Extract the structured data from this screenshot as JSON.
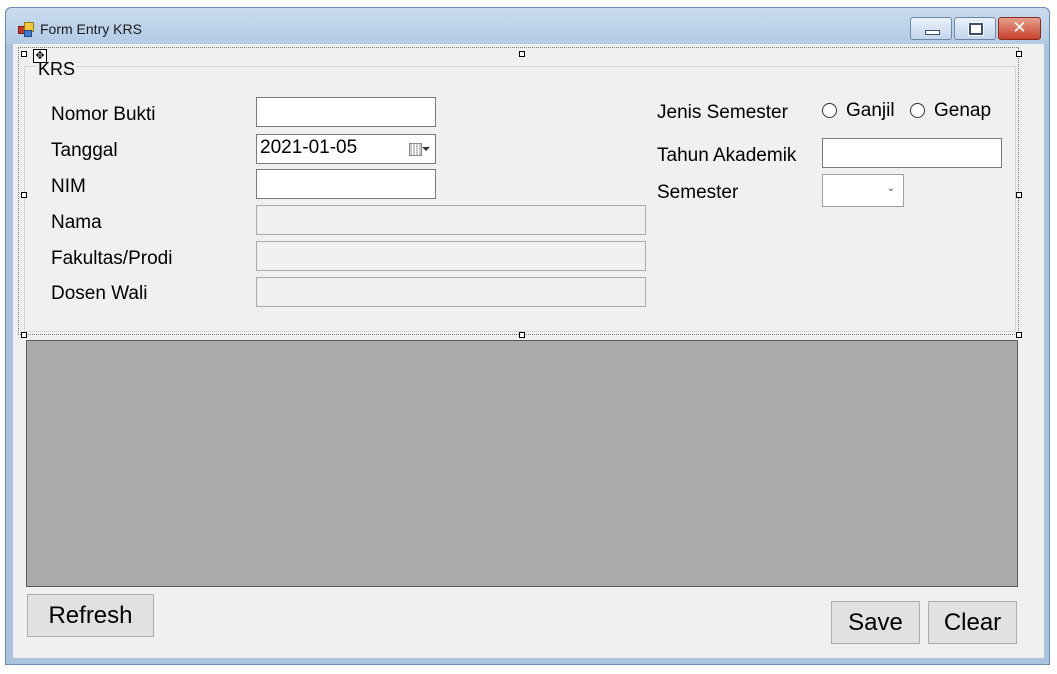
{
  "window": {
    "title": "Form Entry KRS",
    "controls": {
      "minimize": "minimize-icon",
      "maximize": "maximize-icon",
      "close": "close-icon"
    }
  },
  "groupbox": {
    "title": "KRS",
    "left_fields": [
      {
        "label": "Nomor Bukti",
        "value": ""
      },
      {
        "label": "Tanggal",
        "value": "2021-01-05"
      },
      {
        "label": "NIM",
        "value": ""
      },
      {
        "label": "Nama",
        "value": ""
      },
      {
        "label": "Fakultas/Prodi",
        "value": ""
      },
      {
        "label": "Dosen Wali",
        "value": ""
      }
    ],
    "jenis_semester": {
      "label": "Jenis Semester",
      "options": [
        "Ganjil",
        "Genap"
      ]
    },
    "tahun_akademik": {
      "label": "Tahun Akademik",
      "value": ""
    },
    "semester": {
      "label": "Semester",
      "value": ""
    }
  },
  "buttons": {
    "refresh": "Refresh",
    "save": "Save",
    "clear": "Clear"
  },
  "colors": {
    "form_background": "#f0f0f0",
    "grid_background": "#ababab",
    "titlebar": "#b3cbe6",
    "close_button": "#c8412a"
  }
}
